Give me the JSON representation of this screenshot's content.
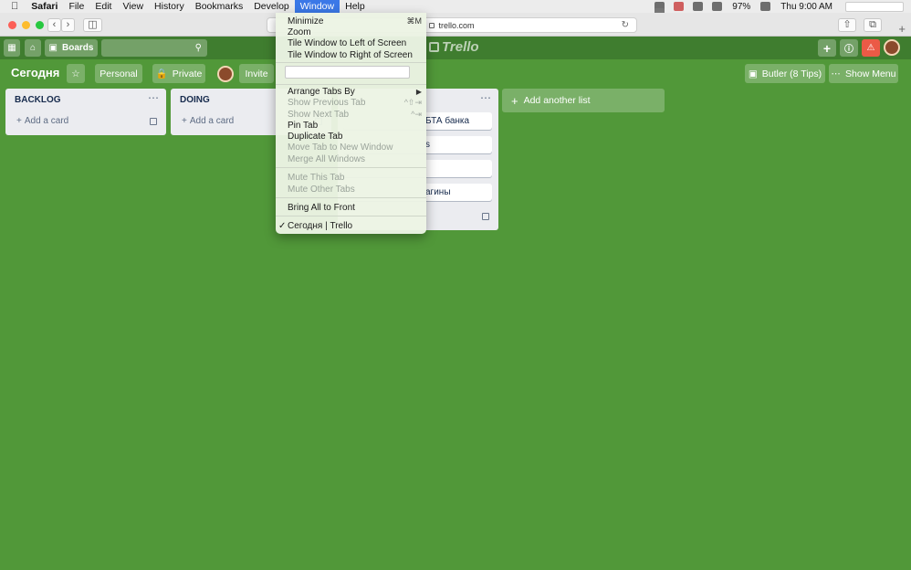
{
  "menubar": {
    "app": "Safari",
    "items": [
      "File",
      "Edit",
      "View",
      "History",
      "Bookmarks",
      "Develop",
      "Window",
      "Help"
    ],
    "battery": "97%",
    "time": "Thu 9:00 AM"
  },
  "safari": {
    "url": "trello.com"
  },
  "trello": {
    "boards_label": "Boards",
    "logo_text": "Trello"
  },
  "board": {
    "title": "Сегодня",
    "personal": "Personal",
    "private": "Private",
    "invite": "Invite",
    "butler": "Butler (8 Tips)",
    "show_menu": "Show Menu",
    "add_list": "Add another list"
  },
  "lists": [
    {
      "title": "BACKLOG",
      "add_card": "Add a card"
    },
    {
      "title": "DOING",
      "add_card": "Add a card"
    },
    {
      "title": "",
      "cards": [
        "БТА банка",
        "s",
        "",
        "агины"
      ]
    }
  ],
  "window_menu": {
    "minimize": "Minimize",
    "minimize_shortcut": "⌘M",
    "zoom": "Zoom",
    "tile_left": "Tile Window to Left of Screen",
    "tile_right": "Tile Window to Right of Screen",
    "arrange": "Arrange Tabs By",
    "arrange_arrow": "▶",
    "prev_tab": "Show Previous Tab",
    "prev_shortcut": "^⇧⇥",
    "next_tab": "Show Next Tab",
    "next_shortcut": "^⇥",
    "pin": "Pin Tab",
    "duplicate": "Duplicate Tab",
    "move_tab": "Move Tab to New Window",
    "merge": "Merge All Windows",
    "mute_this": "Mute This Tab",
    "mute_other": "Mute Other Tabs",
    "bring_front": "Bring All to Front",
    "check": "✓",
    "current": "Сегодня | Trello"
  }
}
